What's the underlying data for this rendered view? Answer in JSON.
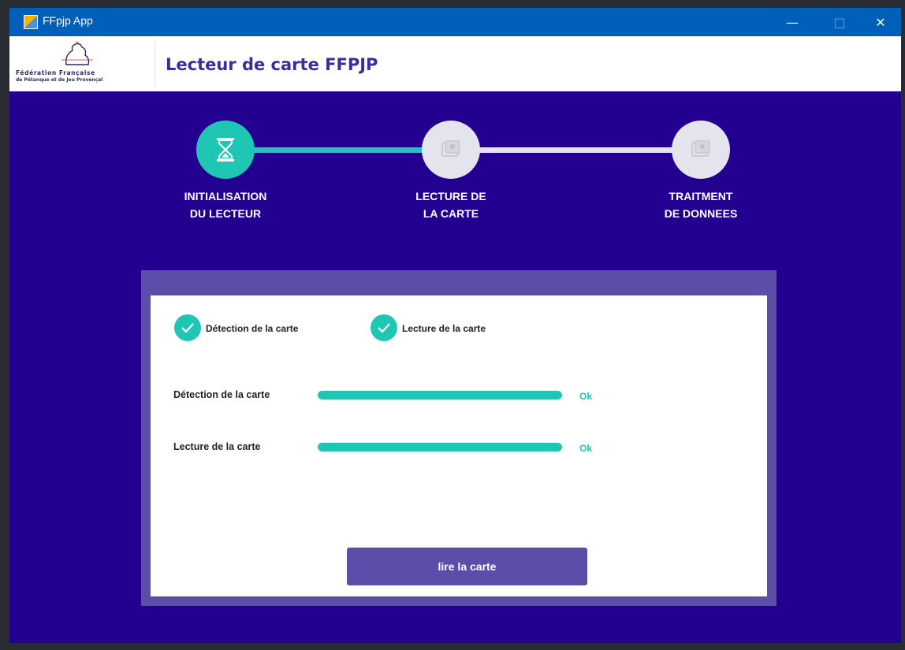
{
  "window": {
    "title": "FFpjp App",
    "controls": {
      "minimize": "—",
      "maximize": "□",
      "close": "✕"
    }
  },
  "header": {
    "logo_line1": "Fédération Française",
    "logo_line2": "de Pétanque et de Jeu Provençal",
    "title": "Lecteur de carte FFPJP"
  },
  "stepper": {
    "steps": [
      {
        "label": "INITIALISATION\nDU LECTEUR",
        "state": "active",
        "icon": "hourglass-icon"
      },
      {
        "label": "LECTURE DE\nLA CARTE",
        "state": "inactive",
        "icon": "card-icon"
      },
      {
        "label": "TRAITMENT\nDE DONNEES",
        "state": "inactive",
        "icon": "card-icon"
      }
    ]
  },
  "checks": [
    {
      "label": "Détection de la carte",
      "done": true
    },
    {
      "label": "Lecture de la carte",
      "done": true
    }
  ],
  "progress": [
    {
      "label": "Détection de la carte",
      "value": 1.0,
      "status": "Ok"
    },
    {
      "label": "Lecture de la carte",
      "value": 1.0,
      "status": "Ok"
    }
  ],
  "actions": {
    "read_button": "lire la carte"
  },
  "colors": {
    "background": "#23008f",
    "accent": "#1fc6b4",
    "panel": "#5b4da8",
    "titlebar": "#005fb8"
  }
}
